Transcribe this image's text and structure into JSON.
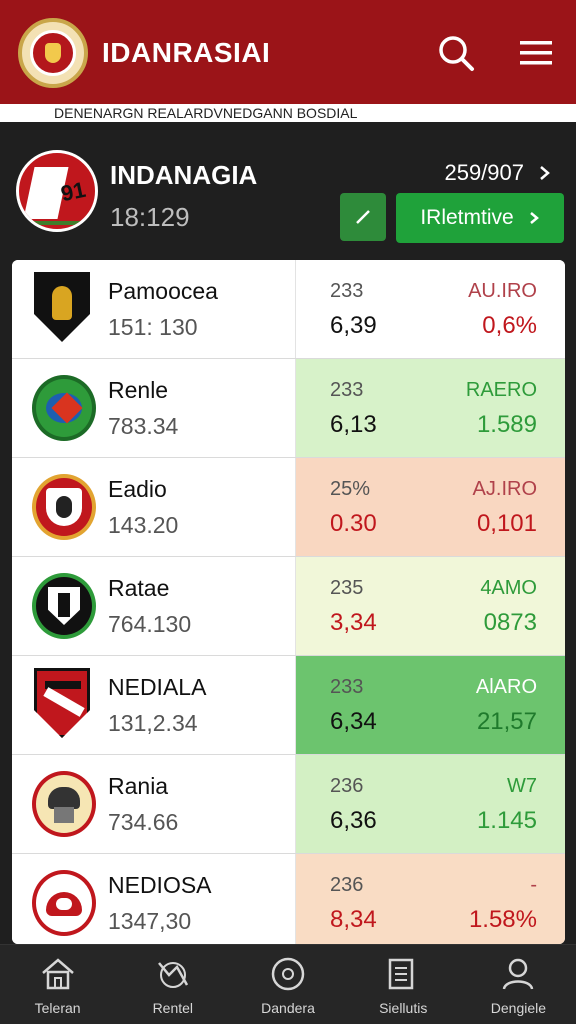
{
  "header": {
    "app_title": "IDANRASIAI",
    "search_icon": "search-icon",
    "menu_icon": "menu-icon"
  },
  "subtitle": "DENENARGN REALARDVNEDGANN BOSDIAL",
  "team": {
    "name": "INDANAGIA",
    "time": "18:129",
    "logo_number": "91",
    "stat": "259/907",
    "cta_label": "IRletmtive"
  },
  "rows": [
    {
      "name": "Pamoocea",
      "sub": "151: 130",
      "c_top": "233",
      "c_bot": "6,39",
      "d_top": "AU.IRO",
      "d_bot": "0,6%",
      "bg": "#ffffff",
      "d_color": "#c0171d",
      "d_top_color": "#b0414a",
      "c_bot_color": "#111111"
    },
    {
      "name": "Renle",
      "sub": "783.34",
      "c_top": "233",
      "c_bot": "6,13",
      "d_top": "RAERO",
      "d_bot": "1.589",
      "bg": "#d7f2c9",
      "d_color": "#2e9b3a",
      "d_top_color": "#2e9b3a",
      "c_bot_color": "#111111"
    },
    {
      "name": "Eadio",
      "sub": "143.20",
      "c_top": "25%",
      "c_bot": "0.30",
      "d_top": "AJ.IRO",
      "d_bot": "0,101",
      "bg": "#f9d7c1",
      "d_color": "#c0171d",
      "d_top_color": "#b0414a",
      "c_bot_color": "#c0171d"
    },
    {
      "name": "Ratae",
      "sub": "764.130",
      "c_top": "235",
      "c_bot": "3,34",
      "d_top": "4AMO",
      "d_bot": "0873",
      "bg": "#f1f7d9",
      "d_color": "#2e9b3a",
      "d_top_color": "#2e9b3a",
      "c_bot_color": "#c0171d"
    },
    {
      "name": "NEDIALA",
      "sub": "131,2.34",
      "c_top": "233",
      "c_bot": "6,34",
      "d_top": "AlARO",
      "d_bot": "21,57",
      "bg": "#6cc46e",
      "d_color": "#1f7a2c",
      "d_top_color": "#ffffff",
      "c_bot_color": "#111111"
    },
    {
      "name": "Rania",
      "sub": "734.66",
      "c_top": "236",
      "c_bot": "6,36",
      "d_top": "W7",
      "d_bot": "1.145",
      "bg": "#d3f0c4",
      "d_color": "#2e9b3a",
      "d_top_color": "#2e9b3a",
      "c_bot_color": "#111111"
    },
    {
      "name": "NEDIOSA",
      "sub": "1347,30",
      "c_top": "236",
      "c_bot": "8,34",
      "d_top": "-",
      "d_bot": "1.58%",
      "bg": "#f9dcc4",
      "d_color": "#c0171d",
      "d_top_color": "#b0414a",
      "c_bot_color": "#c0171d"
    }
  ],
  "nav": [
    {
      "label": "Teleran",
      "icon": "home-icon"
    },
    {
      "label": "Rentel",
      "icon": "chart-icon"
    },
    {
      "label": "Dandera",
      "icon": "ball-icon"
    },
    {
      "label": "Siellutis",
      "icon": "list-icon"
    },
    {
      "label": "Dengiele",
      "icon": "user-icon"
    }
  ]
}
